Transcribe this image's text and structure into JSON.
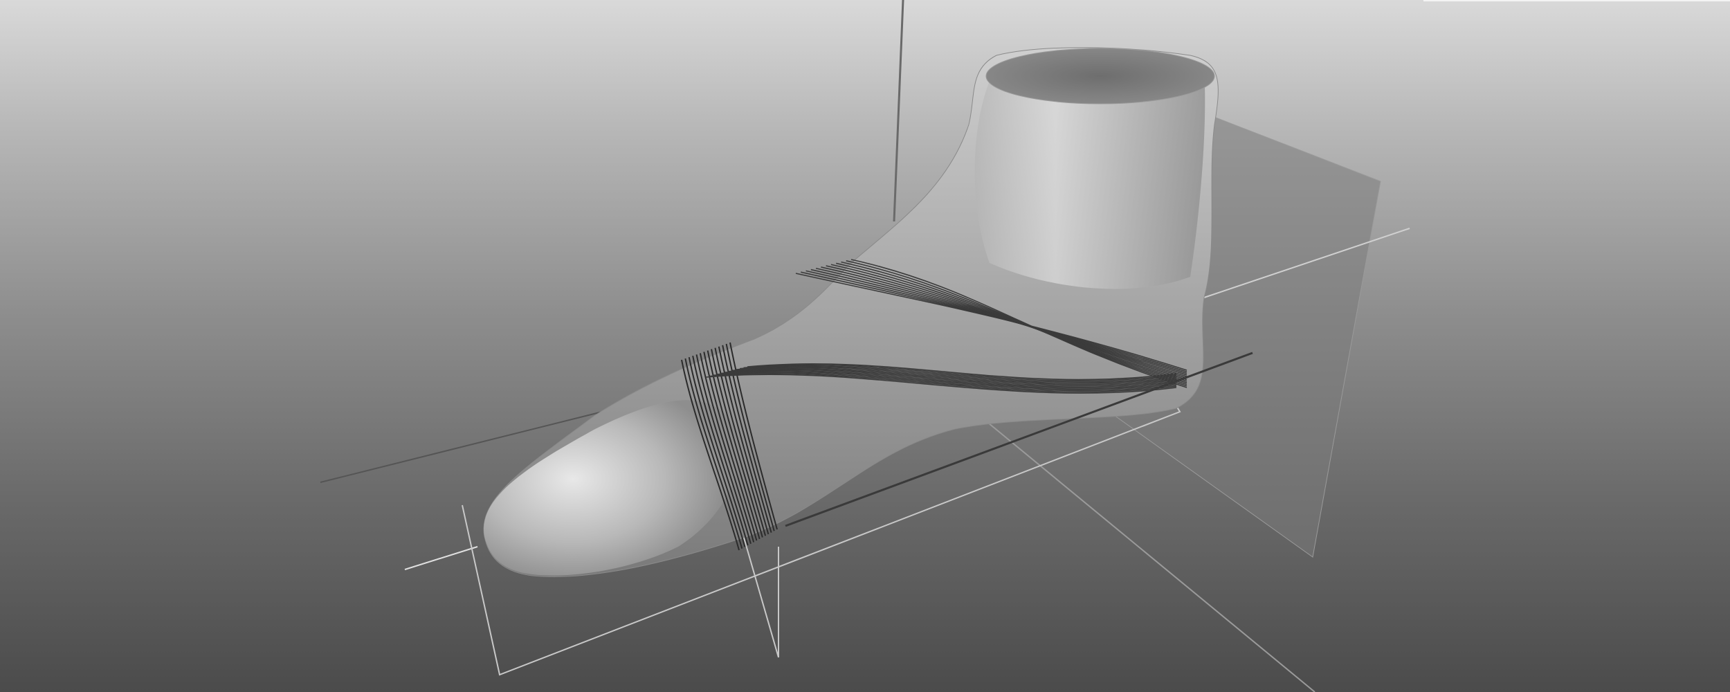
{
  "viewport": {
    "kind": "3d-viewport",
    "background_top": "#d9d9d9",
    "background_bottom": "#4b4b4b"
  },
  "model": {
    "kind": "foot-last-mesh",
    "surface_color": "#bdbdbd",
    "wireframe_curve_color": "#2b2b2b",
    "section_curves": {
      "forefoot_bands": 14,
      "fan_curves": 12
    }
  },
  "reference_geometry": {
    "guide_line_color": "#d8d8d8",
    "plane_color": "#7c7c7c",
    "axis_color": "#3a3a3a"
  }
}
